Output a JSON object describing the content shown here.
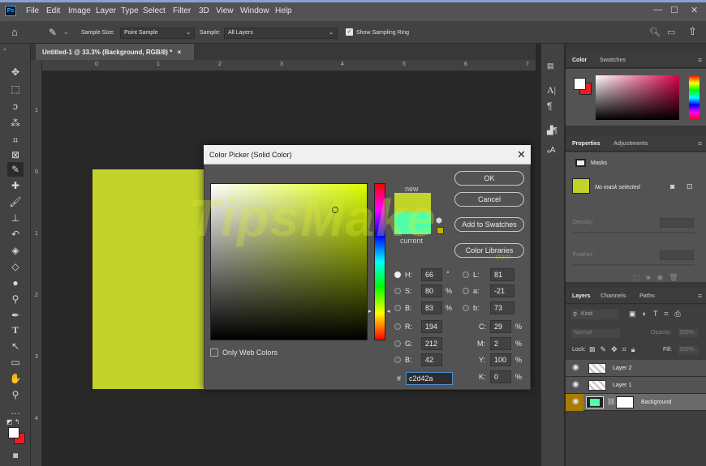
{
  "app": {
    "icon_label": "Ps"
  },
  "menu": [
    "File",
    "Edit",
    "Image",
    "Layer",
    "Type",
    "Select",
    "Filter",
    "3D",
    "View",
    "Window",
    "Help"
  ],
  "options": {
    "sample_size_label": "Sample Size:",
    "sample_size_value": "Point Sample",
    "sample_label": "Sample:",
    "sample_value": "All Layers",
    "sampling_ring_label": "Show Sampling Ring"
  },
  "document": {
    "tab_title": "Untitled-1 @ 33.3% (Background, RGB/8) *",
    "close": "×",
    "ruler_h": [
      "0",
      "1",
      "2",
      "3",
      "4",
      "5",
      "6",
      "7"
    ],
    "ruler_v": [
      "1",
      "0",
      "1",
      "2",
      "3",
      "4"
    ],
    "canvas_color": "#c2d42a"
  },
  "dialog": {
    "title": "Color Picker (Solid Color)",
    "close": "✕",
    "new_label": "new",
    "current_label": "current",
    "new_color": "#c2d42a",
    "current_color": "#4dffa9",
    "buttons": {
      "ok": "OK",
      "cancel": "Cancel",
      "add_swatches": "Add to Swatches",
      "libraries": "Color Libraries"
    },
    "fields": {
      "H": {
        "label": "H:",
        "value": "66",
        "unit": "°"
      },
      "S": {
        "label": "S:",
        "value": "80",
        "unit": "%"
      },
      "B": {
        "label": "B:",
        "value": "83",
        "unit": "%"
      },
      "R": {
        "label": "R:",
        "value": "194"
      },
      "G": {
        "label": "G:",
        "value": "212"
      },
      "Bv": {
        "label": "B:",
        "value": "42"
      },
      "L": {
        "label": "L:",
        "value": "81"
      },
      "a": {
        "label": "a:",
        "value": "-21"
      },
      "b": {
        "label": "b:",
        "value": "73"
      },
      "C": {
        "label": "C:",
        "value": "29",
        "unit": "%"
      },
      "M": {
        "label": "M:",
        "value": "2",
        "unit": "%"
      },
      "Y": {
        "label": "Y:",
        "value": "100",
        "unit": "%"
      },
      "K": {
        "label": "K:",
        "value": "0",
        "unit": "%"
      }
    },
    "hex_label": "#",
    "hex_value": "c2d42a",
    "only_web_label": "Only Web Colors"
  },
  "watermark": {
    "main": "TipsMake",
    "sub": ".com"
  },
  "panels": {
    "color": {
      "tabs": [
        "Color",
        "Swatches"
      ]
    },
    "properties": {
      "tabs": [
        "Properties",
        "Adjustments"
      ],
      "masks": "Masks",
      "mask_status": "No mask selected",
      "density": "Density:",
      "feather": "Feather:"
    },
    "layers": {
      "tabs": [
        "Layers",
        "Channels",
        "Paths"
      ],
      "kind": "Kind",
      "mode": "Normal",
      "opacity_label": "Opacity:",
      "opacity_value": "100%",
      "lock_label": "Lock:",
      "fill_label": "Fill:",
      "fill_value": "100%",
      "items": [
        {
          "name": "Layer 2"
        },
        {
          "name": "Layer 1"
        },
        {
          "name": "Background"
        }
      ]
    }
  }
}
